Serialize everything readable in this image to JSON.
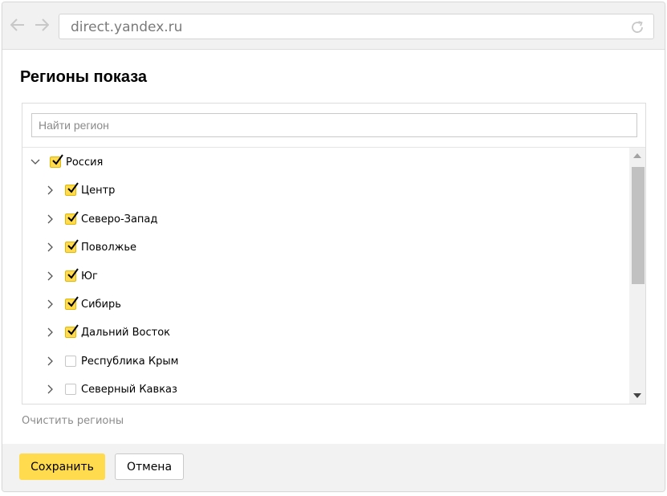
{
  "browser": {
    "url": "direct.yandex.ru"
  },
  "dialog": {
    "title": "Регионы показа",
    "search": {
      "placeholder": "Найти регион",
      "value": ""
    },
    "tree": [
      {
        "label": "Россия",
        "checked": true,
        "expanded": true,
        "level": 0
      },
      {
        "label": "Центр",
        "checked": true,
        "expanded": false,
        "level": 1
      },
      {
        "label": "Северо-Запад",
        "checked": true,
        "expanded": false,
        "level": 1
      },
      {
        "label": "Поволжье",
        "checked": true,
        "expanded": false,
        "level": 1
      },
      {
        "label": "Юг",
        "checked": true,
        "expanded": false,
        "level": 1
      },
      {
        "label": "Сибирь",
        "checked": true,
        "expanded": false,
        "level": 1
      },
      {
        "label": "Дальний Восток",
        "checked": true,
        "expanded": false,
        "level": 1
      },
      {
        "label": "Республика Крым",
        "checked": false,
        "expanded": false,
        "level": 1
      },
      {
        "label": "Северный Кавказ",
        "checked": false,
        "expanded": false,
        "level": 1
      }
    ],
    "clear_link": "Очистить регионы",
    "save_label": "Сохранить",
    "cancel_label": "Отмена"
  },
  "colors": {
    "accent": "#ffdb4d",
    "check_border": "#e0b800"
  },
  "icons": {
    "back": "arrow-left-icon",
    "forward": "arrow-right-icon",
    "reload": "reload-icon",
    "expand": "chevron-right-icon",
    "collapse": "chevron-down-icon",
    "check": "check-icon",
    "scroll_up": "triangle-up-icon",
    "scroll_down": "triangle-down-icon"
  }
}
